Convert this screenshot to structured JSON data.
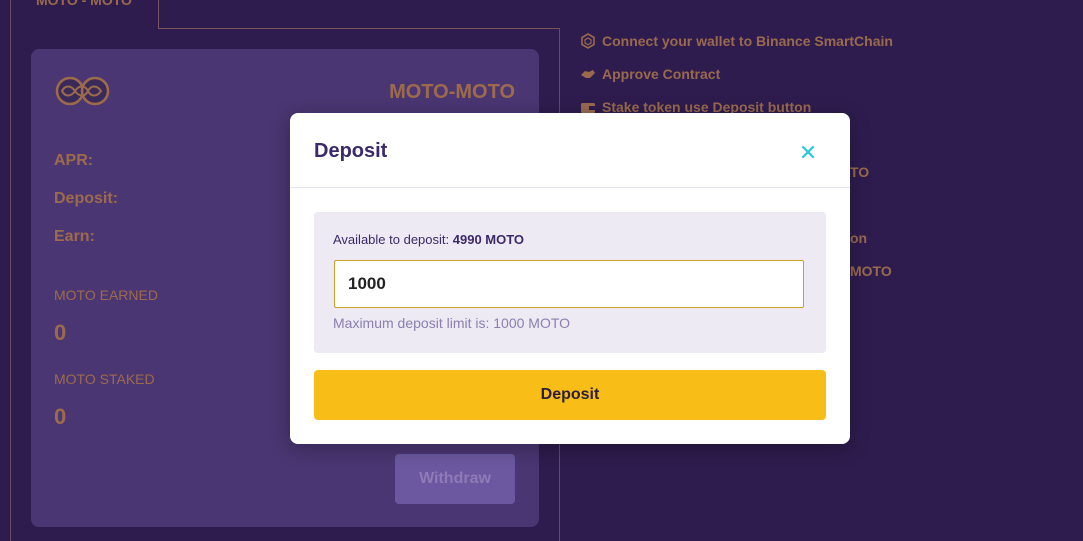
{
  "background": {
    "tab_label": "MOTO - MOTO",
    "pool_card": {
      "title": "MOTO-MOTO",
      "apr_label": "APR:",
      "deposit_label": "Deposit:",
      "earn_label": "Earn:",
      "earned_label": "MOTO EARNED",
      "earned_value": "0",
      "staked_label": "MOTO STAKED",
      "staked_value": "0",
      "withdraw_label": "Withdraw"
    },
    "steps": [
      {
        "label": "Connect your wallet to Binance SmartChain",
        "icon": "hexagon-icon"
      },
      {
        "label": "Approve Contract",
        "icon": "handshake-icon"
      },
      {
        "label": "Stake token use Deposit button",
        "icon": "wallet-icon"
      }
    ],
    "partial_fragments": [
      "TO",
      "on",
      "MOTO"
    ]
  },
  "modal": {
    "title": "Deposit",
    "close_icon": "close-icon",
    "available_prefix": "Available to deposit:",
    "available_amount": "4990 MOTO",
    "input_value": "1000",
    "limit_text": "Maximum deposit limit is: 1000 MOTO",
    "deposit_button": "Deposit"
  },
  "colors": {
    "page_bg": "#2e1c4e",
    "card_bg": "#4a3672",
    "accent_text": "#9d6b4c",
    "primary_button": "#f9bd17",
    "close_icon": "#1fc7d4",
    "modal_title": "#3b2a6b"
  }
}
